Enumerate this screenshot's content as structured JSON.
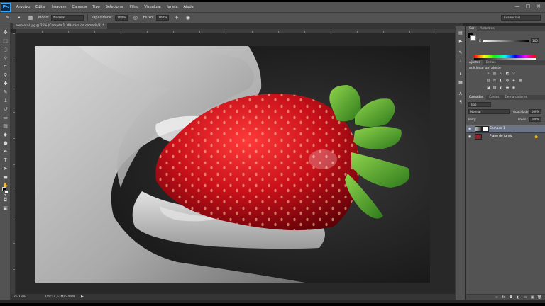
{
  "app": {
    "logo": "Ps"
  },
  "menu": [
    "Arquivo",
    "Editar",
    "Imagem",
    "Camada",
    "Tipo",
    "Selecionar",
    "Filtro",
    "Visualizar",
    "Janela",
    "Ajuda"
  ],
  "window_controls": [
    "—",
    "□",
    "✕"
  ],
  "options": {
    "mode_label": "Modo:",
    "mode_value": "Normal",
    "opacity_label": "Opacidade:",
    "opacity_value": "100%",
    "flow_label": "Fluxo:",
    "flow_value": "100%",
    "workspace": "Essenciais"
  },
  "document": {
    "tab_title": "sexo-oral.jpg @ 25% (Camada 1, Máscara de camada/8) *",
    "zoom": "25,13%",
    "doc_info": "Doc: 4,53M/5,44M"
  },
  "panels": {
    "top_tabs": [
      "Cor",
      "Amostras"
    ],
    "k_label": "K",
    "k_value": "100",
    "mid_tabs": [
      "Ajustes",
      "Estilos"
    ],
    "adjust_title": "Adicionar um ajuste",
    "layer_tabs": [
      "Camadas",
      "Canais",
      "Demarcadores"
    ],
    "kind": "Tipo",
    "blend_mode": "Normal",
    "opacity_label": "Opacidade:",
    "opacity": "100%",
    "lock_label": "Bloq.:",
    "fill_label": "Preen.:",
    "fill": "100%"
  },
  "layers": [
    {
      "name": "Camada 1",
      "selected": true
    },
    {
      "name": "Plano de fundo",
      "selected": false
    }
  ],
  "colors": {
    "accent": "#30a7ff",
    "selected_layer": "#6b7587",
    "strawberry": "#c8101a",
    "leaves": "#4fa82e"
  }
}
